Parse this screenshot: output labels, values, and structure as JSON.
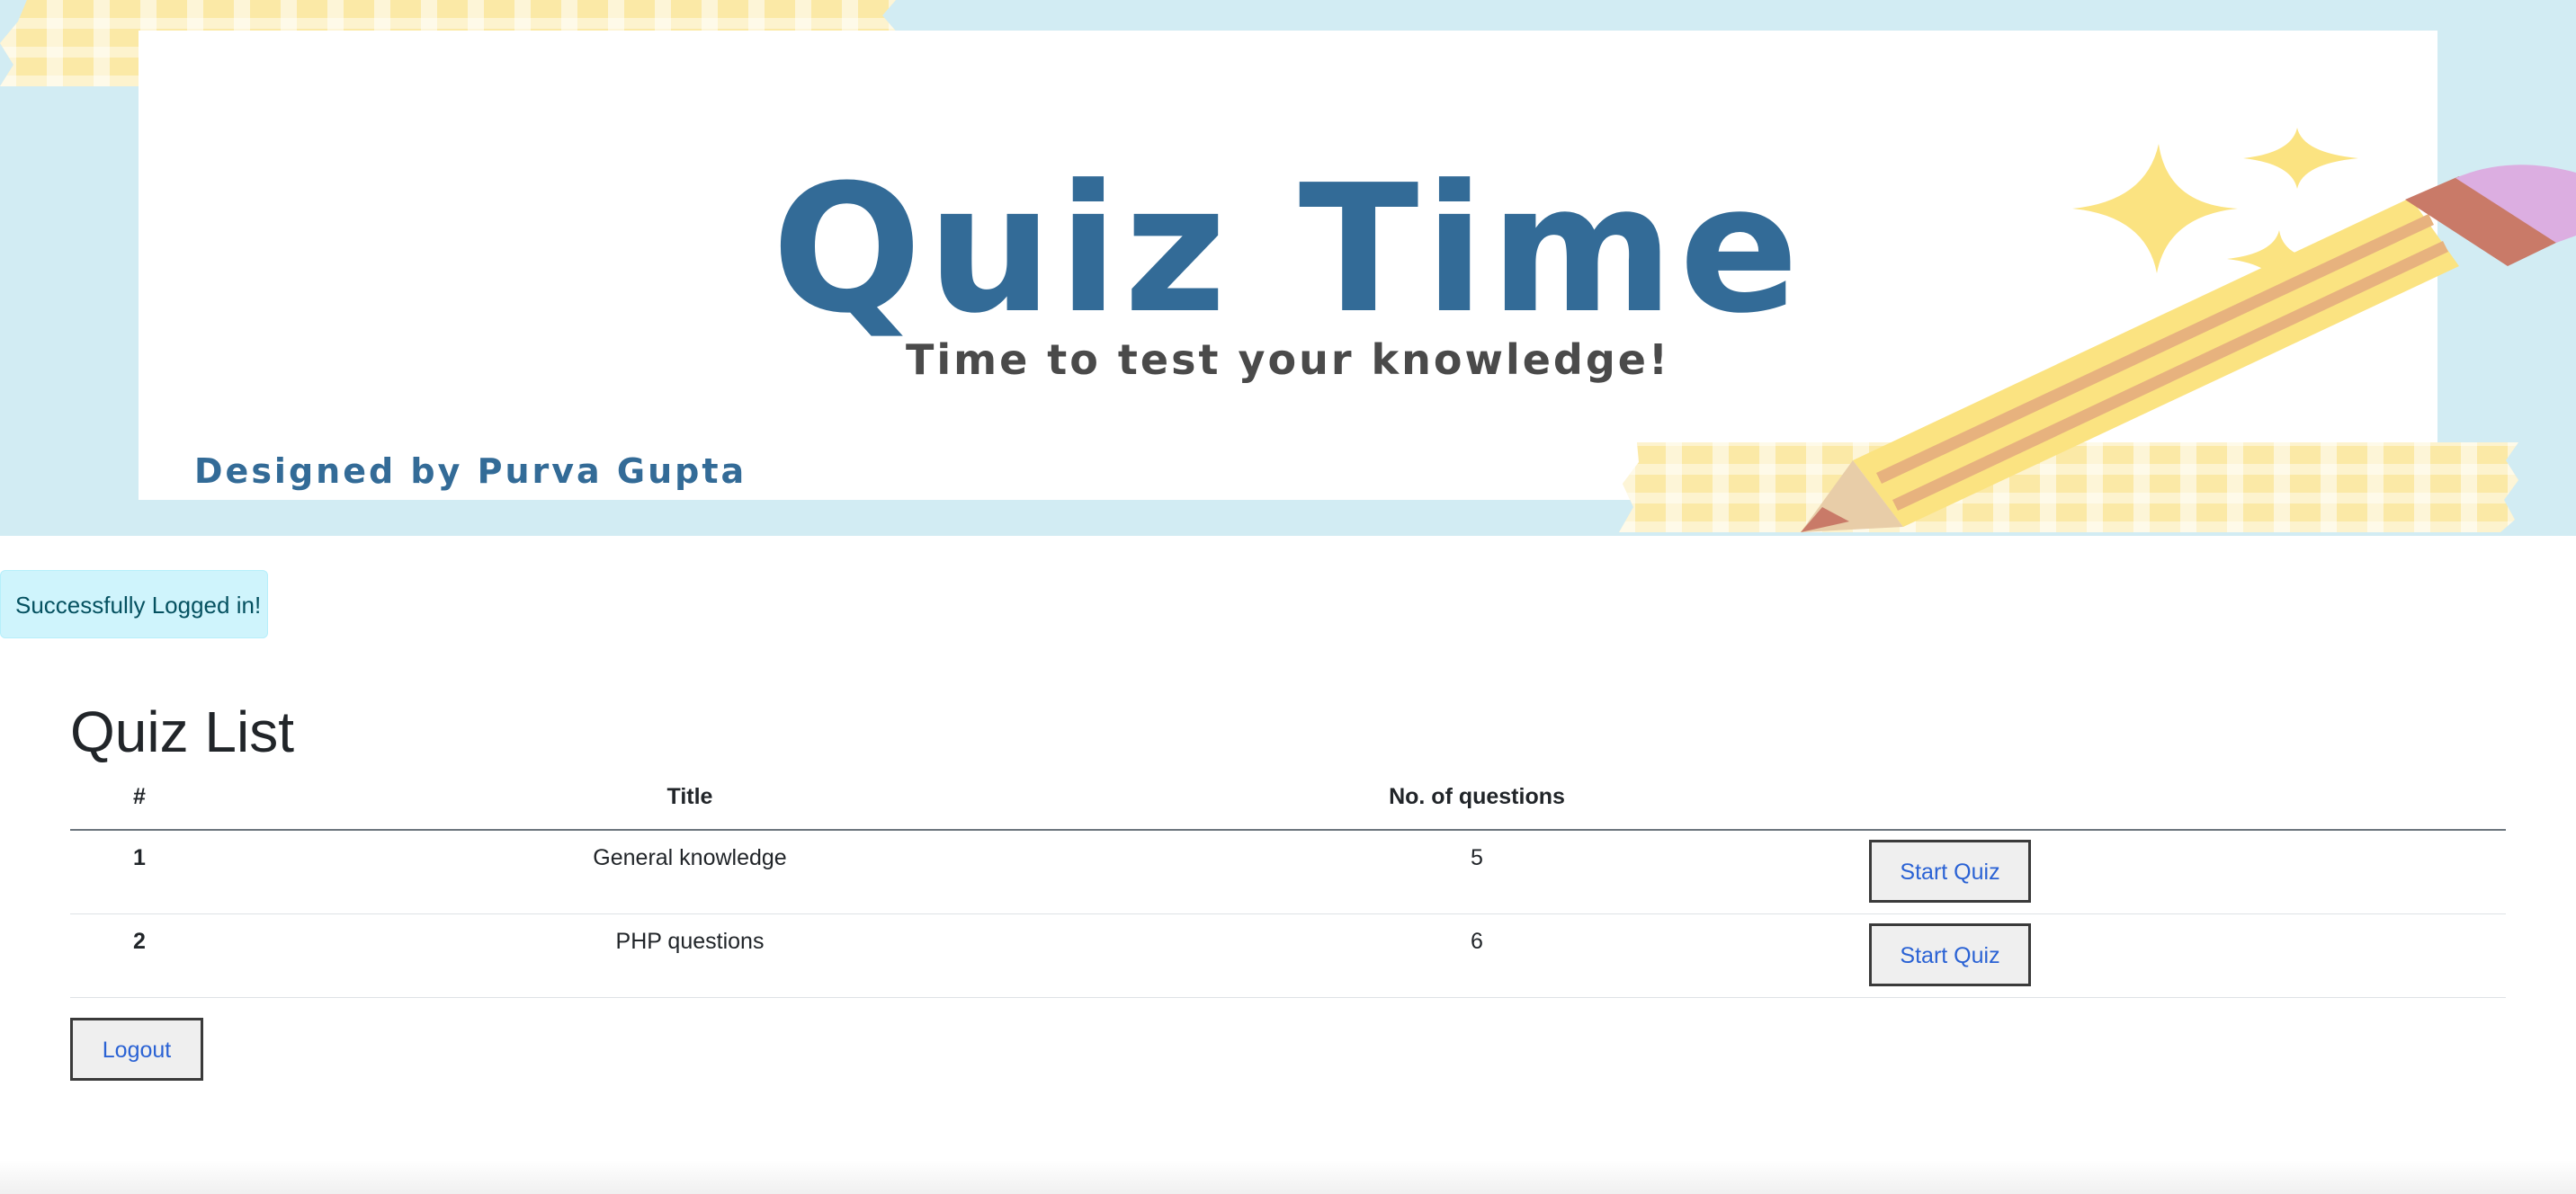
{
  "banner": {
    "title": "Quiz Time",
    "subtitle": "Time to test your knowledge!",
    "credit": "Designed by Purva Gupta",
    "colors": {
      "sky": "#d2ecf3",
      "title": "#336b97",
      "tape": "#fbe9a6",
      "star": "#fbe381"
    }
  },
  "alert": {
    "message": "Successfully Logged in!"
  },
  "quiz_list": {
    "heading": "Quiz List",
    "columns": [
      "#",
      "Title",
      "No. of questions",
      ""
    ],
    "rows": [
      {
        "num": "1",
        "title": "General knowledge",
        "count": "5",
        "action": "Start Quiz"
      },
      {
        "num": "2",
        "title": "PHP questions",
        "count": "6",
        "action": "Start Quiz"
      }
    ]
  },
  "logout": {
    "label": "Logout"
  }
}
